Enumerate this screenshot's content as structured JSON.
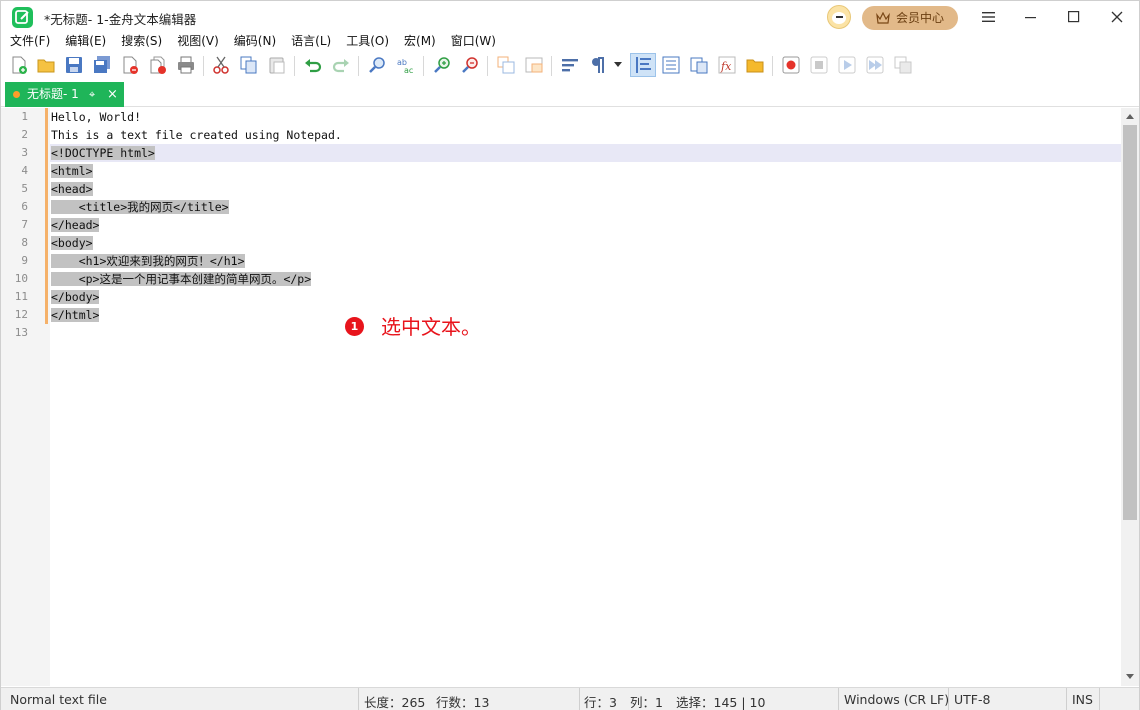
{
  "window": {
    "title": "*无标题- 1-金舟文本编辑器",
    "member_label": "会员中心"
  },
  "menu": [
    "文件(F)",
    "编辑(E)",
    "搜索(S)",
    "视图(V)",
    "编码(N)",
    "语言(L)",
    "工具(O)",
    "宏(M)",
    "窗口(W)"
  ],
  "tab": {
    "label": "无标题- 1",
    "pin": "⌖",
    "close": "×"
  },
  "editor": {
    "line_numbers": [
      "1",
      "2",
      "3",
      "4",
      "5",
      "6",
      "7",
      "8",
      "9",
      "10",
      "11",
      "12",
      "13"
    ],
    "lines": [
      "Hello, World!",
      "This is a text file created using Notepad.",
      "<!DOCTYPE html>",
      "<html>",
      "<head>",
      "    <title>我的网页</title>",
      "</head>",
      "<body>",
      "    <h1>欢迎来到我的网页！</h1>",
      "    <p>这是一个用记事本创建的简单网页。</p>",
      "</body>",
      "</html>",
      ""
    ],
    "selected_lines": [
      3,
      12
    ]
  },
  "annotation": {
    "number": "1",
    "text": "选中文本。"
  },
  "status": {
    "file_type": "Normal text file",
    "length": "长度：265",
    "lines": "行数：13",
    "row": "行：3",
    "col": "列：1",
    "selection": "选择：145 | 10",
    "eol": "Windows (CR LF)",
    "encoding": "UTF-8",
    "mode": "INS"
  },
  "colors": {
    "accent": "#1fb559",
    "selection": "#c2c2c2",
    "annotation": "#e8141c",
    "member": "#e2b989"
  }
}
